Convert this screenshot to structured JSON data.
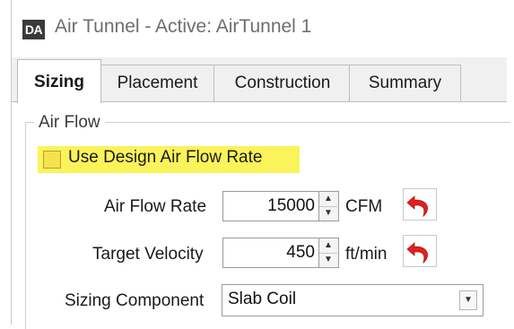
{
  "window": {
    "app_icon_text": "DA",
    "title": "Air Tunnel - Active: AirTunnel 1"
  },
  "tabs": [
    {
      "label": "Sizing",
      "active": true
    },
    {
      "label": "Placement",
      "active": false
    },
    {
      "label": "Construction",
      "active": false
    },
    {
      "label": "Summary",
      "active": false
    }
  ],
  "airflow_group": {
    "legend": "Air Flow",
    "use_design_checkbox": {
      "label": "Use Design Air Flow Rate",
      "checked": false,
      "highlight_color": "#fbf35a"
    },
    "air_flow_rate": {
      "label": "Air Flow Rate",
      "value": "15000",
      "unit": "CFM"
    },
    "target_velocity": {
      "label": "Target Velocity",
      "value": "450",
      "unit": "ft/min"
    },
    "sizing_component": {
      "label": "Sizing Component",
      "value": "Slab Coil"
    }
  },
  "icons": {
    "reset": "undo-arrow-icon",
    "reset_color": "#e02020",
    "spin_up": "chevron-up-icon",
    "spin_down": "chevron-down-icon",
    "dropdown": "dropdown-arrow-icon"
  }
}
